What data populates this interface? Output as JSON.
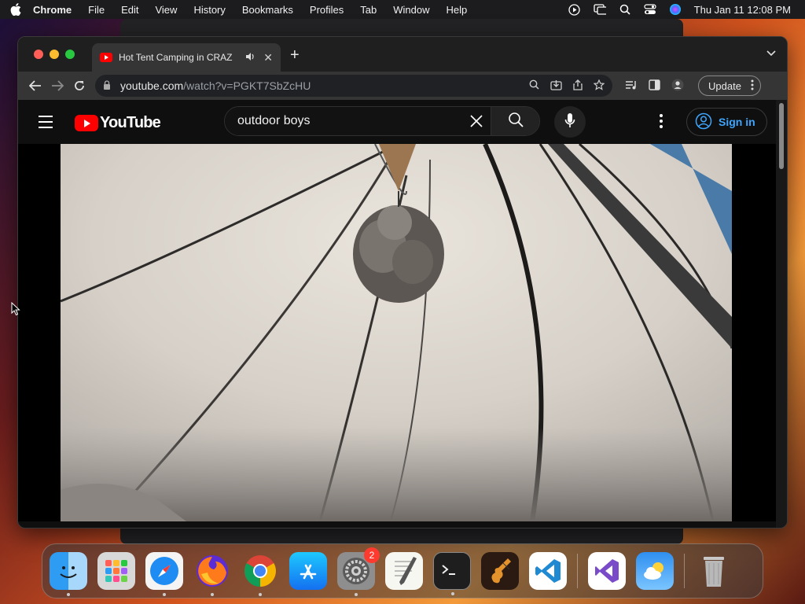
{
  "menubar": {
    "app": "Chrome",
    "items": [
      "File",
      "Edit",
      "View",
      "History",
      "Bookmarks",
      "Profiles",
      "Tab",
      "Window",
      "Help"
    ],
    "clock": "Thu Jan 11  12:08 PM"
  },
  "browser": {
    "tab_title": "Hot Tent Camping in CRAZ",
    "url_host": "youtube.com",
    "url_path": "/watch?v=PGKT7SbZcHU",
    "update_label": "Update"
  },
  "youtube": {
    "logo_text": "YouTube",
    "search_value": "outdoor boys",
    "signin_label": "Sign in"
  },
  "dock": {
    "settings_badge": "2"
  },
  "colors": {
    "youtube_red": "#ff0000",
    "signin_blue": "#3ea6ff",
    "traffic_red": "#ff5f57",
    "traffic_yellow": "#febc2e",
    "traffic_green": "#28c840"
  }
}
